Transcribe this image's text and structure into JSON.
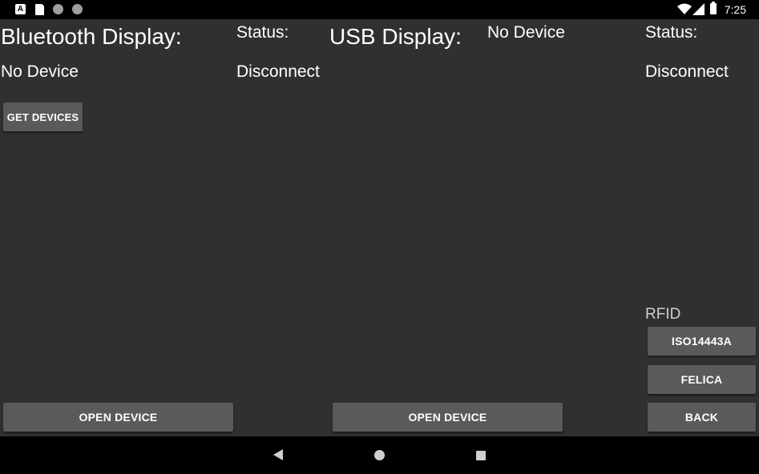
{
  "status_bar": {
    "time": "7:25",
    "left_icons": [
      "notification-a-icon",
      "sd-card-icon",
      "circle-icon",
      "circle-icon"
    ],
    "right_icons": [
      "wifi-icon",
      "signal-icon",
      "battery-icon"
    ]
  },
  "bluetooth": {
    "title": "Bluetooth Display:",
    "device": "No Device",
    "status_label": "Status:",
    "status_value": "Disconnect",
    "get_devices_label": "GET DEVICES",
    "open_device_label": "OPEN DEVICE"
  },
  "usb": {
    "title": "USB Display:",
    "device": "No Device",
    "status_label": "Status:",
    "status_value": "Disconnect",
    "open_device_label": "OPEN DEVICE"
  },
  "rfid": {
    "label": "RFID",
    "iso_label": "ISO14443A",
    "felica_label": "FELICA",
    "back_label": "BACK"
  },
  "nav_bar": {
    "icons": [
      "back-icon",
      "home-icon",
      "recents-icon"
    ]
  }
}
